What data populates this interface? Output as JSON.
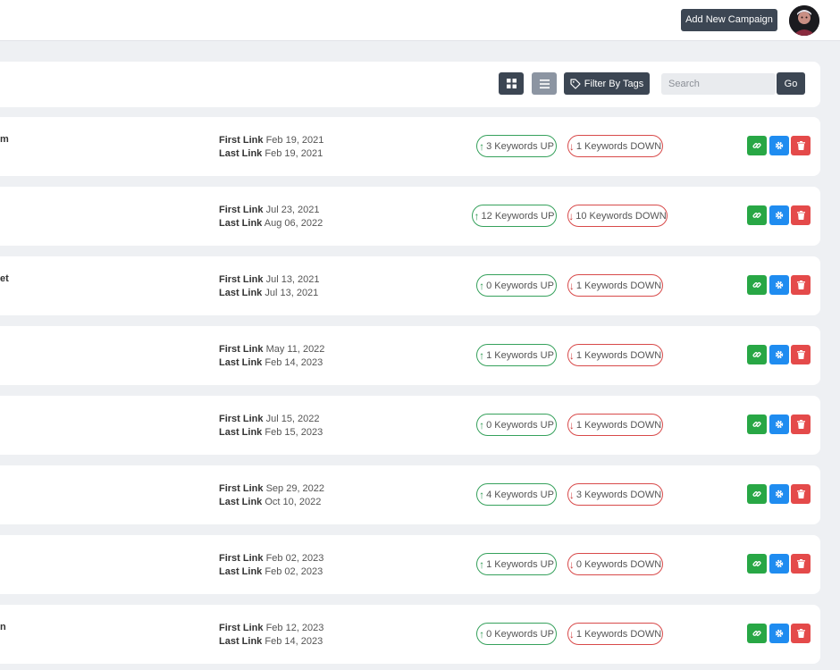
{
  "header": {
    "add_campaign_label": "Add New Campaign",
    "avatar_icon": "user-avatar"
  },
  "toolbar": {
    "grid_view_icon": "grid-icon",
    "list_view_icon": "list-icon",
    "filter_label": "Filter By Tags",
    "filter_icon": "tag-icon",
    "search_placeholder": "Search",
    "go_label": "Go"
  },
  "labels": {
    "first_link": "First Link",
    "last_link": "Last Link"
  },
  "colors": {
    "dark_button": "#3c4653",
    "up_green": "#36a15c",
    "down_red": "#d84a4a",
    "link_button": "#28a745",
    "settings_button": "#1f8cf0",
    "delete_button": "#e44a4a"
  },
  "rows": [
    {
      "name_fragment": "m",
      "first_date": "Feb 19, 2021",
      "last_date": "Feb 19, 2021",
      "up_text": "3 Keywords UP",
      "down_text": "1 Keywords DOWN"
    },
    {
      "name_fragment": "",
      "first_date": "Jul 23, 2021",
      "last_date": "Aug 06, 2022",
      "up_text": "12 Keywords UP",
      "down_text": "10 Keywords DOWN"
    },
    {
      "name_fragment": "et",
      "first_date": "Jul 13, 2021",
      "last_date": "Jul 13, 2021",
      "up_text": "0 Keywords UP",
      "down_text": "1 Keywords DOWN"
    },
    {
      "name_fragment": "",
      "first_date": "May 11, 2022",
      "last_date": "Feb 14, 2023",
      "up_text": "1 Keywords UP",
      "down_text": "1 Keywords DOWN"
    },
    {
      "name_fragment": "",
      "first_date": "Jul 15, 2022",
      "last_date": "Feb 15, 2023",
      "up_text": "0 Keywords UP",
      "down_text": "1 Keywords DOWN"
    },
    {
      "name_fragment": "",
      "first_date": "Sep 29, 2022",
      "last_date": "Oct 10, 2022",
      "up_text": "4 Keywords UP",
      "down_text": "3 Keywords DOWN"
    },
    {
      "name_fragment": "",
      "first_date": "Feb 02, 2023",
      "last_date": "Feb 02, 2023",
      "up_text": "1 Keywords UP",
      "down_text": "0 Keywords DOWN"
    },
    {
      "name_fragment": "n",
      "first_date": "Feb 12, 2023",
      "last_date": "Feb 14, 2023",
      "up_text": "0 Keywords UP",
      "down_text": "1 Keywords DOWN"
    }
  ]
}
